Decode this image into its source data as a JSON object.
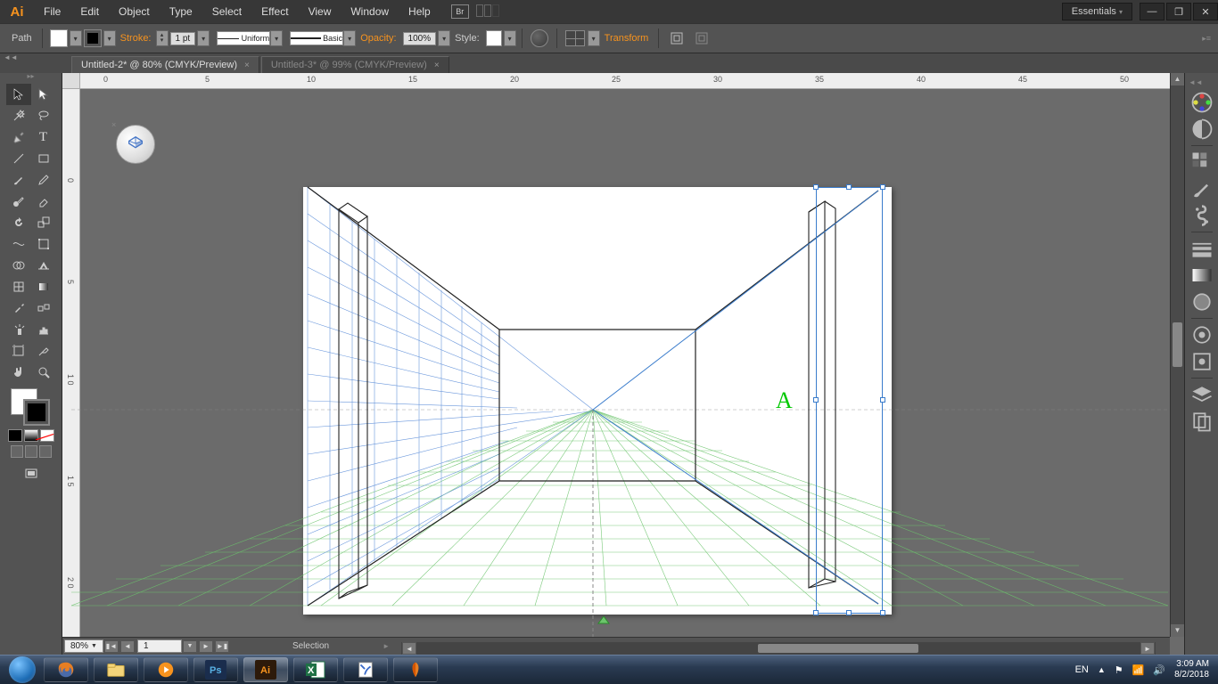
{
  "menu": [
    "File",
    "Edit",
    "Object",
    "Type",
    "Select",
    "Effect",
    "View",
    "Window",
    "Help"
  ],
  "workspace": "Essentials",
  "control": {
    "label": "Path",
    "stroke": "Stroke:",
    "stroke_val": "1 pt",
    "uniform": "Uniform",
    "basic": "Basic",
    "opacity_lbl": "Opacity:",
    "opacity_val": "100%",
    "style_lbl": "Style:",
    "transform": "Transform"
  },
  "tabs": [
    {
      "title": "Untitled-2* @ 80% (CMYK/Preview)",
      "active": true
    },
    {
      "title": "Untitled-3* @ 99% (CMYK/Preview)",
      "active": false
    }
  ],
  "ruler_h": [
    "0",
    "5",
    "10",
    "15",
    "20",
    "25",
    "30",
    "35",
    "40",
    "45",
    "50"
  ],
  "ruler_v": [
    "0",
    "5",
    "1 0",
    "1 5",
    "2 0"
  ],
  "canvas_letter": "A",
  "status": {
    "zoom": "80%",
    "page": "1",
    "mode": "Selection"
  },
  "tray": {
    "lang": "EN",
    "time": "3:09 AM",
    "date": "8/2/2018"
  }
}
